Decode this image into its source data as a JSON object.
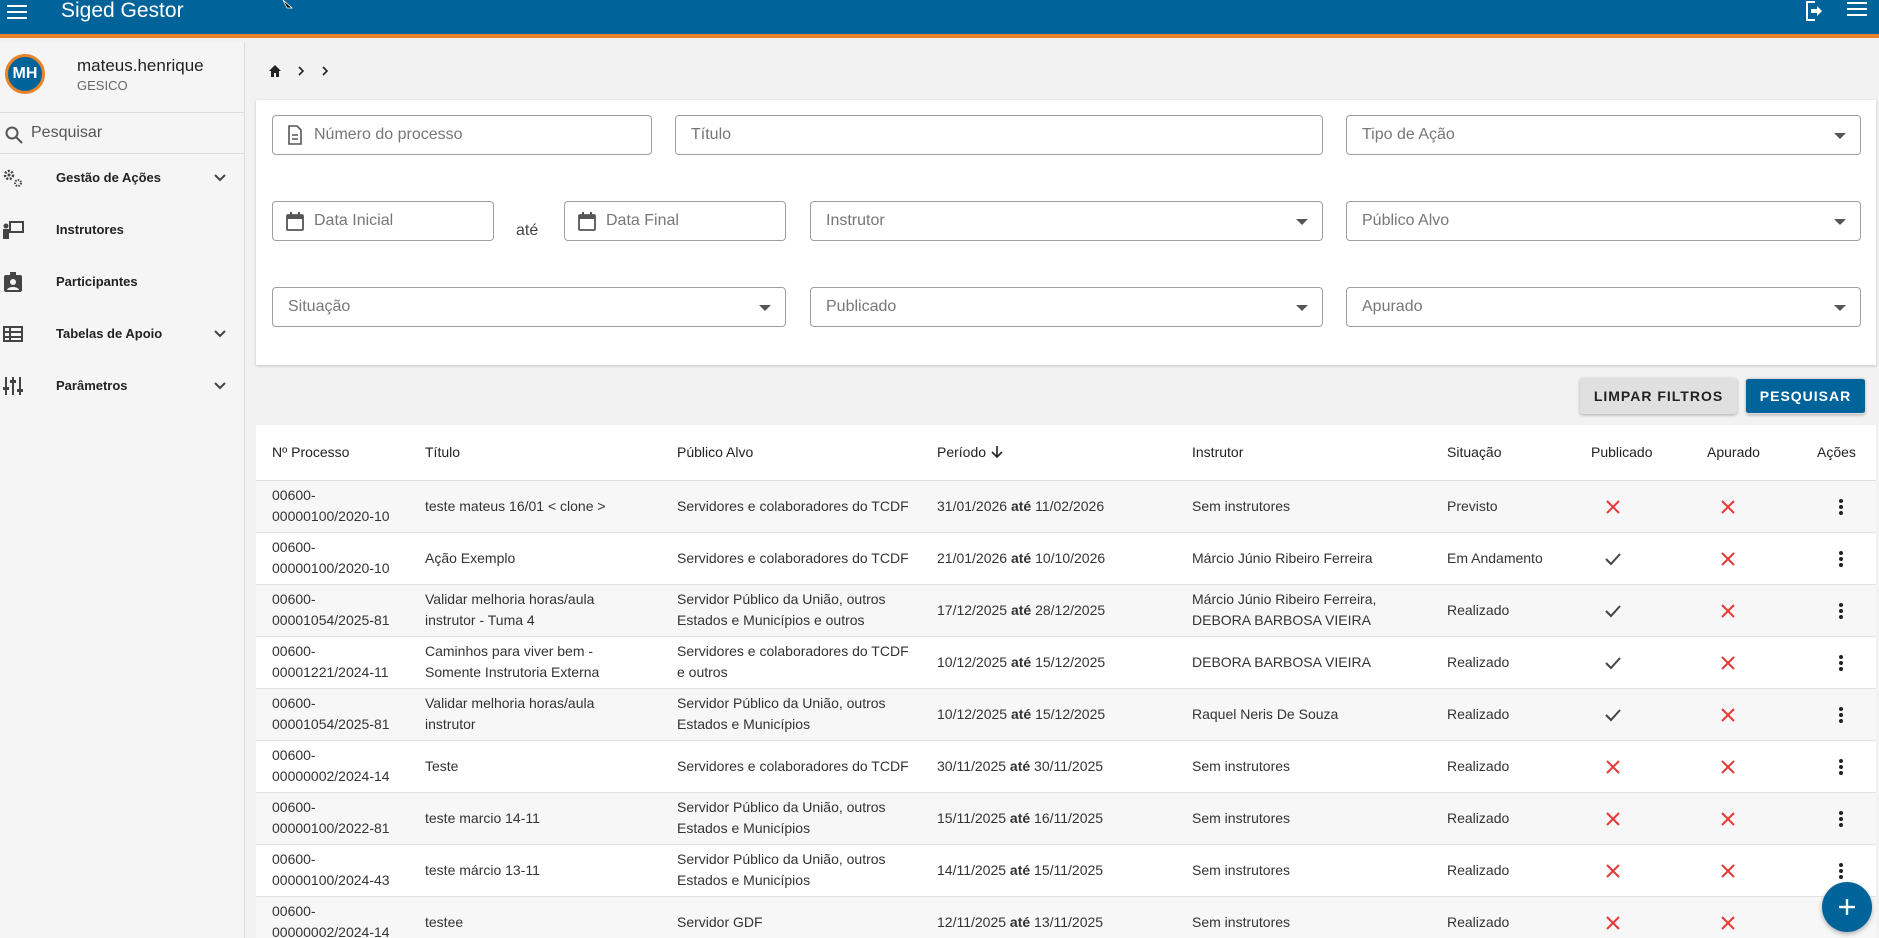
{
  "app": {
    "title": "Siged Gestor"
  },
  "user": {
    "initials": "MH",
    "name": "mateus.henrique",
    "org": "GESICO"
  },
  "sidebar": {
    "search_placeholder": "Pesquisar",
    "items": [
      {
        "label": "Gestão de Ações",
        "icon": "gears-icon",
        "expandable": true
      },
      {
        "label": "Instrutores",
        "icon": "instructor-icon",
        "expandable": false
      },
      {
        "label": "Participantes",
        "icon": "badge-icon",
        "expandable": false
      },
      {
        "label": "Tabelas de Apoio",
        "icon": "table-icon",
        "expandable": true
      },
      {
        "label": "Parâmetros",
        "icon": "sliders-icon",
        "expandable": true
      }
    ]
  },
  "filters": {
    "numero_processo": "Número do processo",
    "titulo": "Título",
    "tipo_acao": "Tipo de Ação",
    "data_inicial": "Data Inicial",
    "ate": "até",
    "data_final": "Data Final",
    "instrutor": "Instrutor",
    "publico_alvo": "Público Alvo",
    "situacao": "Situação",
    "publicado": "Publicado",
    "apurado": "Apurado"
  },
  "buttons": {
    "clear": "LIMPAR FILTROS",
    "search": "PESQUISAR"
  },
  "table": {
    "headers": {
      "processo": "Nº Processo",
      "titulo": "Título",
      "publico": "Público Alvo",
      "periodo": "Período",
      "instrutor": "Instrutor",
      "situacao": "Situação",
      "publicado": "Publicado",
      "apurado": "Apurado",
      "acoes": "Ações"
    },
    "period_separator": "até",
    "rows": [
      {
        "processo": [
          "00600-",
          "00000100/2020-10"
        ],
        "titulo": [
          "teste mateus 16/01 < clone >"
        ],
        "publico": [
          "Servidores e colaboradores do TCDF"
        ],
        "inicio": "31/01/2026",
        "fim": "11/02/2026",
        "instrutor": [
          "Sem instrutores"
        ],
        "situacao": "Previsto",
        "publicado": false,
        "apurado": false
      },
      {
        "processo": [
          "00600-",
          "00000100/2020-10"
        ],
        "titulo": [
          "Ação Exemplo"
        ],
        "publico": [
          "Servidores e colaboradores do TCDF"
        ],
        "inicio": "21/01/2026",
        "fim": "10/10/2026",
        "instrutor": [
          "Márcio Júnio Ribeiro Ferreira"
        ],
        "situacao": "Em Andamento",
        "publicado": true,
        "apurado": false
      },
      {
        "processo": [
          "00600-",
          "00001054/2025-81"
        ],
        "titulo": [
          "Validar melhoria horas/aula",
          "instrutor - Tuma 4"
        ],
        "publico": [
          "Servidor Público da União, outros",
          "Estados e Municípios e outros"
        ],
        "inicio": "17/12/2025",
        "fim": "28/12/2025",
        "instrutor": [
          "Márcio Júnio Ribeiro Ferreira,",
          "DEBORA BARBOSA VIEIRA"
        ],
        "situacao": "Realizado",
        "publicado": true,
        "apurado": false
      },
      {
        "processo": [
          "00600-",
          "00001221/2024-11"
        ],
        "titulo": [
          "Caminhos para viver bem -",
          "Somente Instrutoria Externa"
        ],
        "publico": [
          "Servidores e colaboradores do TCDF",
          "e outros"
        ],
        "inicio": "10/12/2025",
        "fim": "15/12/2025",
        "instrutor": [
          "DEBORA BARBOSA VIEIRA"
        ],
        "situacao": "Realizado",
        "publicado": true,
        "apurado": false
      },
      {
        "processo": [
          "00600-",
          "00001054/2025-81"
        ],
        "titulo": [
          "Validar melhoria horas/aula",
          "instrutor"
        ],
        "publico": [
          "Servidor Público da União, outros",
          "Estados e Municípios"
        ],
        "inicio": "10/12/2025",
        "fim": "15/12/2025",
        "instrutor": [
          "Raquel Neris De Souza"
        ],
        "situacao": "Realizado",
        "publicado": true,
        "apurado": false
      },
      {
        "processo": [
          "00600-",
          "00000002/2024-14"
        ],
        "titulo": [
          "Teste"
        ],
        "publico": [
          "Servidores e colaboradores do TCDF"
        ],
        "inicio": "30/11/2025",
        "fim": "30/11/2025",
        "instrutor": [
          "Sem instrutores"
        ],
        "situacao": "Realizado",
        "publicado": false,
        "apurado": false
      },
      {
        "processo": [
          "00600-",
          "00000100/2022-81"
        ],
        "titulo": [
          "teste marcio 14-11"
        ],
        "publico": [
          "Servidor Público da União, outros",
          "Estados e Municípios"
        ],
        "inicio": "15/11/2025",
        "fim": "16/11/2025",
        "instrutor": [
          "Sem instrutores"
        ],
        "situacao": "Realizado",
        "publicado": false,
        "apurado": false
      },
      {
        "processo": [
          "00600-",
          "00000100/2024-43"
        ],
        "titulo": [
          "teste márcio 13-11"
        ],
        "publico": [
          "Servidor Público da União, outros",
          "Estados e Municípios"
        ],
        "inicio": "14/11/2025",
        "fim": "15/11/2025",
        "instrutor": [
          "Sem instrutores"
        ],
        "situacao": "Realizado",
        "publicado": false,
        "apurado": false
      },
      {
        "processo": [
          "00600-",
          "00000002/2024-14"
        ],
        "titulo": [
          "testee"
        ],
        "publico": [
          "Servidor GDF"
        ],
        "inicio": "12/11/2025",
        "fim": "13/11/2025",
        "instrutor": [
          "Sem instrutores"
        ],
        "situacao": "Realizado",
        "publicado": false,
        "apurado": false
      }
    ]
  },
  "colors": {
    "primary": "#00639a",
    "accent": "#e8832a",
    "no": "#e53935",
    "yes": "#444444"
  }
}
